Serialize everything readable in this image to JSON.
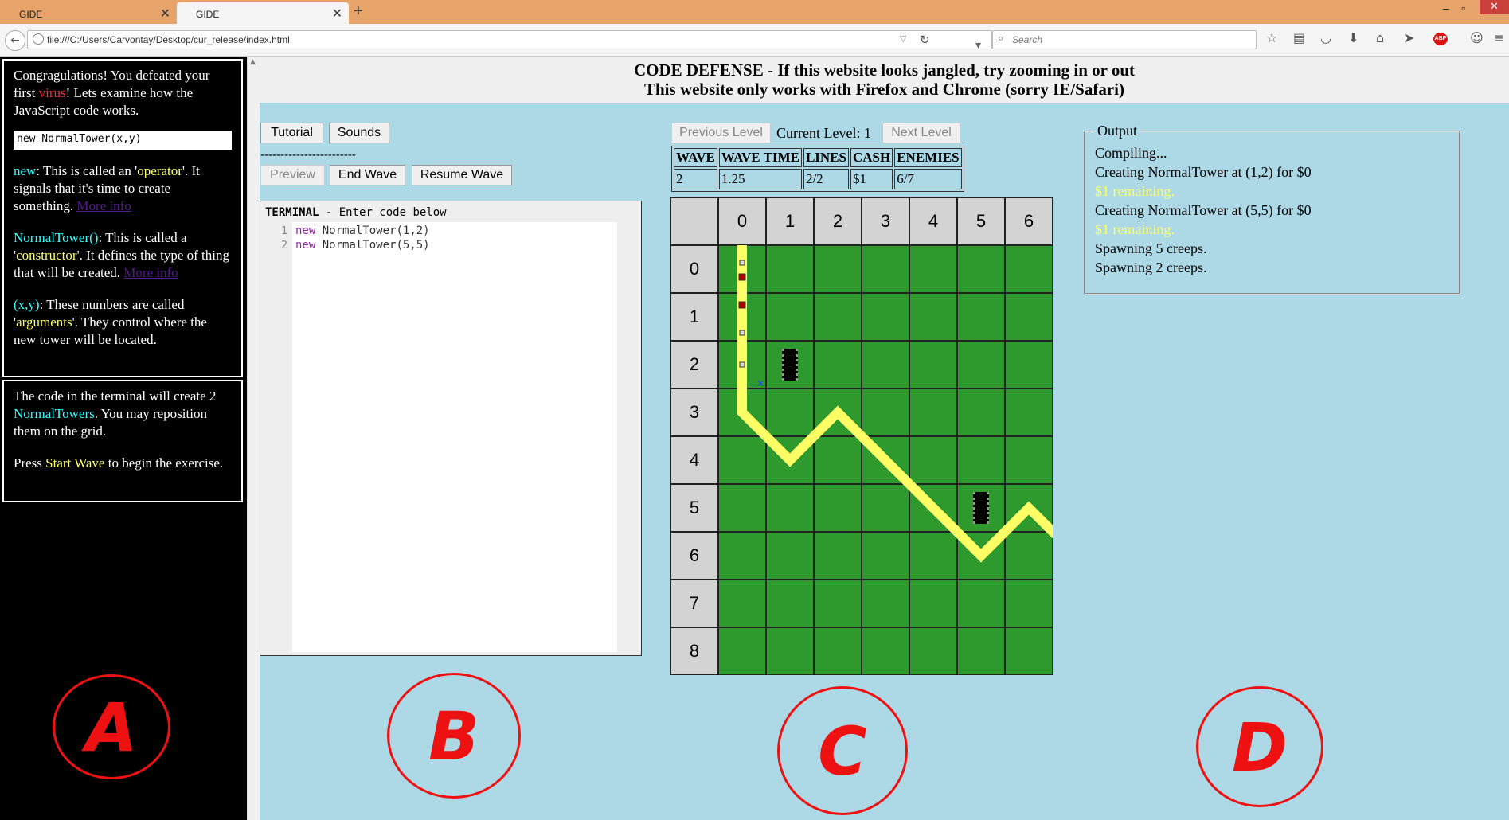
{
  "browser": {
    "tabs": [
      {
        "label": "GIDE"
      },
      {
        "label": "GIDE"
      }
    ],
    "url": "file:///C:/Users/Carvontay/Desktop/cur_release/index.html",
    "search_placeholder": "Search",
    "abp_label": "ABP"
  },
  "page": {
    "header_line1": "CODE DEFENSE - If this website looks jangled, try zooming in or out",
    "header_line2": "This website only works with Firefox and Chrome (sorry IE/Safari)"
  },
  "left": {
    "intro_a": "Congragulations! You defeated your first ",
    "intro_virus": "virus",
    "intro_b": "! Lets examine how the JavaScript code works.",
    "code_example": "new NormalTower(x,y)",
    "new_term": "new",
    "new_a": ": This is called an '",
    "new_operator": "operator",
    "new_b": "'. It signals that it's time to create something. ",
    "more_info": "More info",
    "ctor_term": "NormalTower()",
    "ctor_a": ": This is called a '",
    "ctor_word": "constructor",
    "ctor_b": "'. It defines the type of thing that will be created. ",
    "args_term": "(x,y)",
    "args_a": ": These numbers are called '",
    "args_word": "arguments",
    "args_b": "'. They control where the new tower will be located.",
    "box2_a": "The code in the terminal will create 2 ",
    "box2_towers": "NormalTowers",
    "box2_b": ". You may reposition them on the grid.",
    "press_a": "Press ",
    "press_start": "Start Wave",
    "press_b": " to begin the exercise."
  },
  "controls": {
    "tutorial": "Tutorial",
    "sounds": "Sounds",
    "separator": "------------------------",
    "preview": "Preview",
    "end_wave": "End Wave",
    "resume_wave": "Resume Wave",
    "previous_level": "Previous Level",
    "current_level": "Current Level: 1",
    "next_level": "Next Level"
  },
  "terminal": {
    "title_bold": "TERMINAL",
    "title_rest": " - Enter code below",
    "lines": [
      {
        "num": "1",
        "kw": "new",
        "rest": " NormalTower(1,2)"
      },
      {
        "num": "2",
        "kw": "new",
        "rest": " NormalTower(5,5)"
      }
    ]
  },
  "stats": {
    "headers": [
      "WAVE",
      "WAVE TIME",
      "LINES",
      "CASH",
      "ENEMIES"
    ],
    "values": [
      "2",
      "1.25",
      "2/2",
      "$1",
      "6/7"
    ]
  },
  "grid": {
    "col_labels": [
      "0",
      "1",
      "2",
      "3",
      "4",
      "5",
      "6"
    ],
    "row_labels": [
      "0",
      "1",
      "2",
      "3",
      "4",
      "5",
      "6",
      "7",
      "8"
    ],
    "path_color": "#ffff66",
    "ground_color": "#2e9a2e",
    "towers": [
      {
        "x": 1,
        "y": 2
      },
      {
        "x": 5,
        "y": 5
      }
    ]
  },
  "output": {
    "legend": "Output",
    "lines": [
      {
        "text": "Compiling...",
        "color": "#000000"
      },
      {
        "text": "Creating NormalTower at (1,2) for $0",
        "color": "#000000"
      },
      {
        "text": "$1 remaining.",
        "color": "#ffff66"
      },
      {
        "text": "Creating NormalTower at (5,5) for $0",
        "color": "#000000"
      },
      {
        "text": "$1 remaining.",
        "color": "#ffff66"
      },
      {
        "text": "Spawning 5 creeps.",
        "color": "#000000"
      },
      {
        "text": "Spawning 2 creeps.",
        "color": "#000000"
      }
    ]
  },
  "annotations": [
    "A",
    "B",
    "C",
    "D"
  ]
}
